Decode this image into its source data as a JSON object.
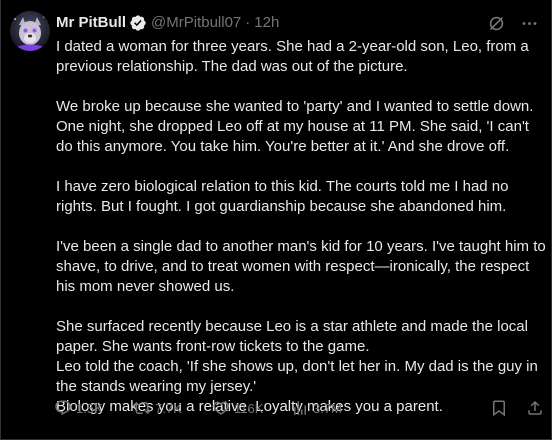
{
  "author": {
    "display_name": "Mr PitBull",
    "handle": "@MrPitbull07",
    "separator": "·",
    "time": "12h"
  },
  "icons": {
    "avatar": "avatar-image",
    "verified": "verified-badge-icon",
    "grok": "grok-icon",
    "more": "more-options-icon",
    "reply": "reply-icon",
    "repost": "repost-icon",
    "like": "heart-icon",
    "views": "views-chart-icon",
    "bookmark": "bookmark-icon",
    "share": "share-icon"
  },
  "colors": {
    "background": "#000000",
    "text": "#e7e9ea",
    "muted": "#71767b",
    "verified": "#1d9bf0"
  },
  "paragraphs": [
    "I dated a woman for three years. She had a 2-year-old son, Leo, from a previous relationship. The dad was out of the picture.",
    "We broke up because she wanted to 'party' and I wanted to settle down. One night, she dropped Leo off at my house at 11 PM. She said, 'I can't do this anymore. You take him. You're better at it.' And she drove off.",
    "I have zero biological relation to this kid. The courts told me I had no rights. But I fought. I got guardianship because she abandoned him.",
    "I've been a single dad to another man's kid for 10 years. I've taught him to shave, to drive, and to treat women with respect—ironically, the respect his mom never showed us.",
    "She surfaced recently because Leo is a star athlete and made the local paper. She wants front-row tickets to the game.\nLeo told the coach, 'If she shows up, don't let her in. My dad is the guy in the stands wearing my jersey.'\nBiology makes you a relative. Loyalty makes you a parent."
  ],
  "stats": {
    "replies": "1.5K",
    "reposts": "7.7K",
    "likes": "116K",
    "views": "3.7M"
  }
}
